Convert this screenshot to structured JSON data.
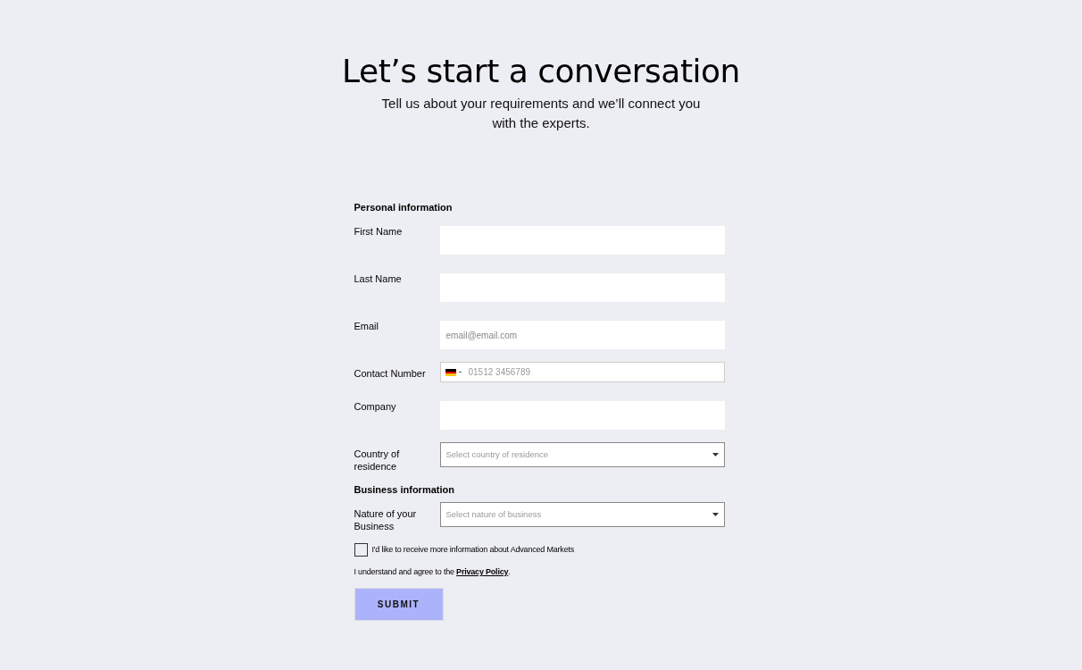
{
  "heading": "Let’s start a conversation",
  "subtitle": "Tell us about your requirements and we’ll connect you with the experts.",
  "sections": [
    {
      "title": "Personal information",
      "fields": [
        {
          "label": "First Name",
          "kind": "text"
        },
        {
          "label": "Last Name",
          "kind": "text"
        },
        {
          "label": "Email",
          "kind": "text",
          "placeholder": "email@email.com"
        },
        {
          "label": "Contact Number",
          "kind": "phone",
          "placeholder": "01512 3456789"
        },
        {
          "label": "Company",
          "kind": "text"
        },
        {
          "label": "Country of residence",
          "kind": "select",
          "placeholder": "Select country of residence"
        }
      ]
    },
    {
      "title": "Business information",
      "fields": [
        {
          "label": "Nature of your Business",
          "kind": "select",
          "placeholder": "Select nature of business"
        }
      ]
    }
  ],
  "consent": {
    "label": "I'd like to receive more information about Advanced Markets",
    "checked": false
  },
  "agreement": {
    "text": "I understand and agree to the",
    "link": "Privacy Policy",
    "suffix": "."
  },
  "submit": "SUBMIT"
}
